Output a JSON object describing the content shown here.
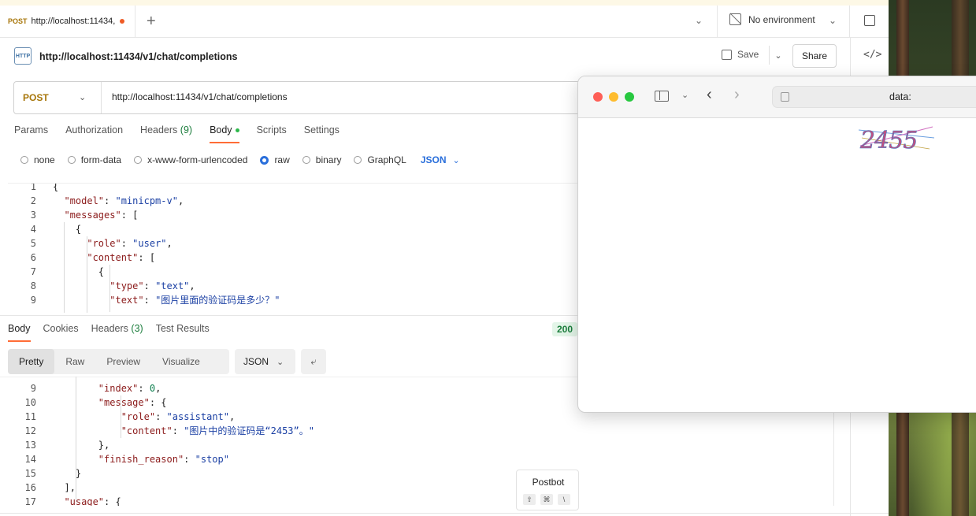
{
  "tab": {
    "method": "POST",
    "label": "http://localhost:11434,"
  },
  "environment": {
    "label": "No environment"
  },
  "request": {
    "title": "http://localhost:11434/v1/chat/completions",
    "save_label": "Save",
    "share_label": "Share",
    "method": "POST",
    "url": "http://localhost:11434/v1/chat/completions",
    "http_badge": "HTTP"
  },
  "request_tabs": {
    "params": "Params",
    "authorization": "Authorization",
    "headers": "Headers",
    "headers_count": "(9)",
    "body": "Body",
    "scripts": "Scripts",
    "settings": "Settings"
  },
  "body_types": {
    "none": "none",
    "form_data": "form-data",
    "urlencoded": "x-www-form-urlencoded",
    "raw": "raw",
    "binary": "binary",
    "graphql": "GraphQL",
    "json": "JSON"
  },
  "request_body": [
    {
      "n": "1",
      "t": "{"
    },
    {
      "n": "2",
      "t": "  \"model\": \"minicpm-v\","
    },
    {
      "n": "3",
      "t": "  \"messages\": ["
    },
    {
      "n": "4",
      "t": "    {"
    },
    {
      "n": "5",
      "t": "      \"role\": \"user\","
    },
    {
      "n": "6",
      "t": "      \"content\": ["
    },
    {
      "n": "7",
      "t": "        {"
    },
    {
      "n": "8",
      "t": "          \"type\": \"text\","
    },
    {
      "n": "9",
      "t": "          \"text\": \"图片里面的验证码是多少？\""
    }
  ],
  "response_tabs": {
    "body": "Body",
    "cookies": "Cookies",
    "headers": "Headers",
    "headers_count": "(3)",
    "test_results": "Test Results",
    "status": "200"
  },
  "view_tabs": {
    "pretty": "Pretty",
    "raw": "Raw",
    "preview": "Preview",
    "visualize": "Visualize"
  },
  "format": "JSON",
  "response_body": [
    {
      "n": "9",
      "t": "        \"index\": 0,"
    },
    {
      "n": "10",
      "t": "        \"message\": {"
    },
    {
      "n": "11",
      "t": "            \"role\": \"assistant\","
    },
    {
      "n": "12",
      "t": "            \"content\": \"图片中的验证码是“2453”。\""
    },
    {
      "n": "13",
      "t": "        },"
    },
    {
      "n": "14",
      "t": "        \"finish_reason\": \"stop\""
    },
    {
      "n": "15",
      "t": "    }"
    },
    {
      "n": "16",
      "t": "  ],"
    },
    {
      "n": "17",
      "t": "  \"usage\": {"
    }
  ],
  "postbot": {
    "label": "Postbot",
    "keys": [
      "⇧",
      "⌘",
      "\\"
    ]
  },
  "safari": {
    "address": "data:",
    "captcha_text": "2455"
  },
  "colors": {
    "accent": "#ff6c37",
    "method": "#a7760a",
    "status_ok": "#1b7d3c",
    "link_blue": "#2a6fdb"
  }
}
